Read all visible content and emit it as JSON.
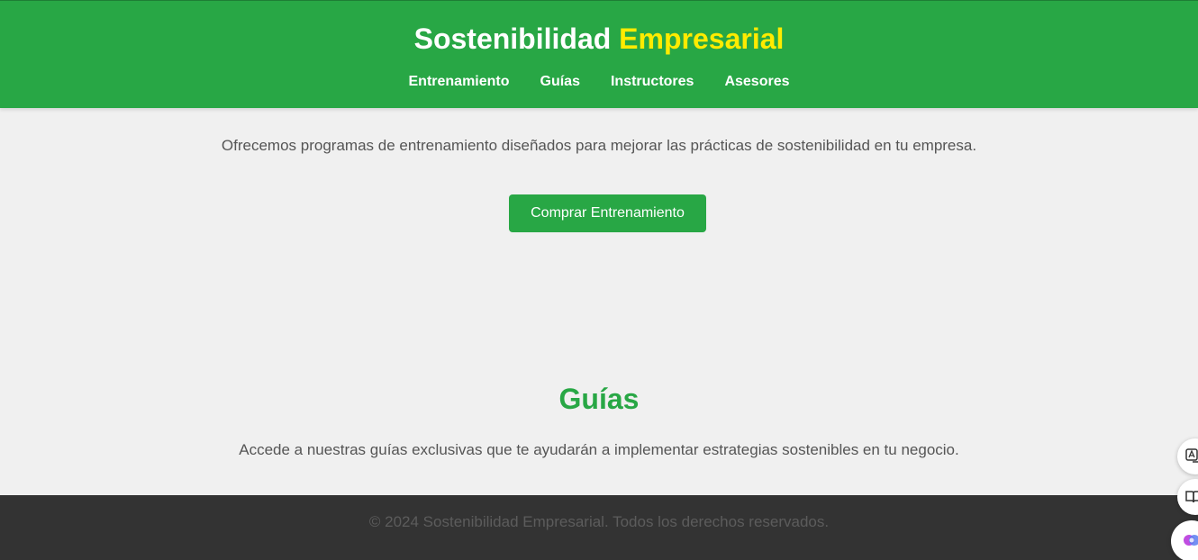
{
  "header": {
    "title_main": "Sostenibilidad",
    "title_accent": "Empresarial",
    "nav": [
      {
        "label": "Entrenamiento"
      },
      {
        "label": "Guías"
      },
      {
        "label": "Instructores"
      },
      {
        "label": "Asesores"
      }
    ]
  },
  "training": {
    "description": "Ofrecemos programas de entrenamiento diseñados para mejorar las prácticas de sostenibilidad en tu empresa.",
    "button_label": "Comprar Entrenamiento"
  },
  "guides": {
    "title": "Guías",
    "description": "Accede a nuestras guías exclusivas que te ayudarán a implementar estrategias sostenibles en tu negocio."
  },
  "footer": {
    "text": "© 2024 Sostenibilidad Empresarial. Todos los derechos reservados."
  },
  "floating_tools": [
    {
      "icon": "translate-icon"
    },
    {
      "icon": "reader-icon"
    },
    {
      "icon": "ai-assistant-icon"
    }
  ],
  "colors": {
    "brand_green": "#28a745",
    "accent_yellow": "#ffeb00",
    "footer_bg": "#333333",
    "page_bg": "#f0f0f0"
  }
}
